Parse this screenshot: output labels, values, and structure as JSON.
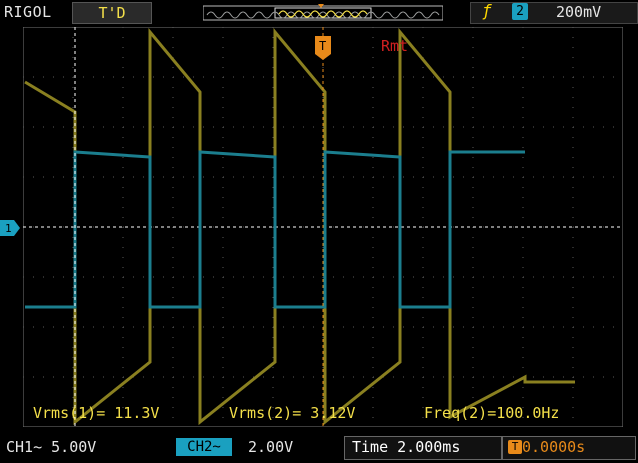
{
  "header": {
    "brand": "RIGOL",
    "status": "T'D",
    "trigger_source": "2",
    "trigger_level": "200mV",
    "trigger_edge_icon": "rising-edge-icon"
  },
  "screen": {
    "mode_label": "Rmt",
    "trigger_marker": "T",
    "ch_ground_marker": "1"
  },
  "measurements": {
    "vrms1": "Vrms(1)= 11.3V",
    "vrms2": "Vrms(2)= 3.12V",
    "freq2": "Freq(2)=100.0Hz"
  },
  "footer": {
    "ch1_scale": "CH1~  5.00V",
    "ch2_tag": "CH2~",
    "ch2_scale": "2.00V",
    "timebase": "Time 2.000ms",
    "trigger_offset": "0.0000s"
  },
  "colors": {
    "ch1": "#8a8020",
    "ch2": "#1b7e8e",
    "grid": "#5a5a5a",
    "cursor": "#ffffff",
    "trigger": "#e88a1a"
  },
  "chart_data": {
    "type": "line",
    "x_unit": "ms",
    "time_per_div_ms": 2.0,
    "x_divisions": 12,
    "y_divisions": 8,
    "series": [
      {
        "name": "CH1",
        "volts_per_div": 5.0,
        "x": [
          0,
          2.0,
          2.0,
          5.0,
          5.0,
          7.0,
          7.0,
          10.0,
          10.0,
          12.0,
          12.0,
          15.0,
          15.0,
          17.0,
          17.0,
          20.0,
          20.0,
          22.0
        ],
        "y": [
          2.9,
          2.3,
          -3.9,
          -2.7,
          3.9,
          2.7,
          -3.9,
          -2.7,
          3.9,
          2.7,
          -3.9,
          -2.7,
          3.9,
          2.7,
          -3.8,
          -3.0,
          -3.1,
          -3.1
        ]
      },
      {
        "name": "CH2",
        "volts_per_div": 2.0,
        "x": [
          0,
          2.0,
          2.0,
          5.0,
          5.0,
          7.0,
          7.0,
          10.0,
          10.0,
          12.0,
          12.0,
          15.0,
          15.0,
          17.0,
          17.0,
          20.0
        ],
        "y": [
          -1.6,
          -1.6,
          1.5,
          1.4,
          -1.6,
          -1.6,
          1.5,
          1.4,
          -1.6,
          -1.6,
          1.5,
          1.4,
          -1.6,
          -1.6,
          1.5,
          1.5
        ]
      }
    ]
  }
}
